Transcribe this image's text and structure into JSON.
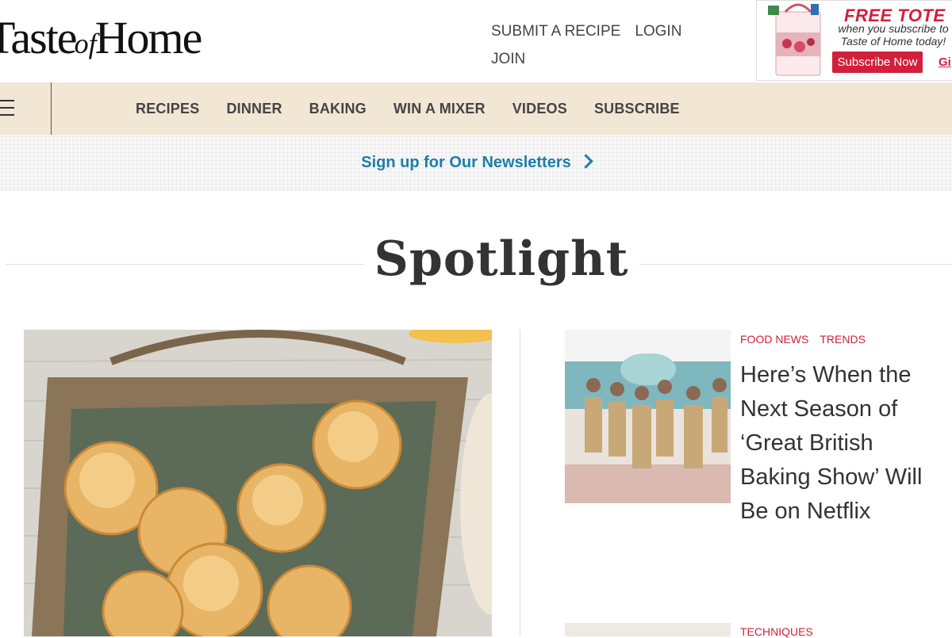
{
  "header": {
    "logo_main_1": "Taste",
    "logo_of": "of",
    "logo_main_2": "Home",
    "links": [
      "SUBMIT A RECIPE",
      "LOGIN",
      "JOIN"
    ]
  },
  "promo": {
    "headline": "FREE TOTE",
    "subtext": "when you subscribe to Taste of Home today!",
    "button": "Subscribe Now",
    "gift": "Gi"
  },
  "nav": {
    "items": [
      "RECIPES",
      "DINNER",
      "BAKING",
      "WIN A MIXER",
      "VIDEOS",
      "SUBSCRIBE"
    ]
  },
  "newsletter": {
    "label": "Sign up for Our Newsletters"
  },
  "spotlight": {
    "title": "Spotlight"
  },
  "cards": [
    {
      "tags": [
        "FOOD NEWS",
        "TRENDS"
      ],
      "title": "Here’s When the Next Season of ‘Great British Baking Show’ Will Be on Netflix"
    },
    {
      "tags": [
        "TECHNIQUES"
      ]
    }
  ],
  "colors": {
    "accent_red": "#d21f3c",
    "link_blue": "#1e7ea6",
    "nav_bg": "#f2e6d4"
  }
}
